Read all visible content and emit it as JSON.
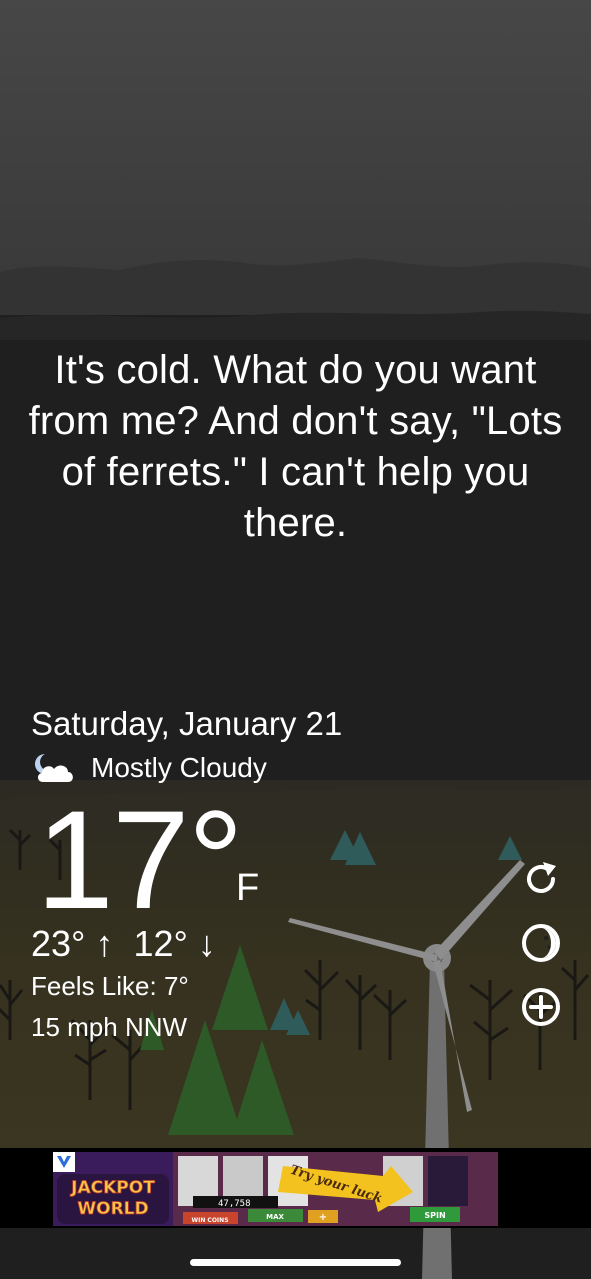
{
  "quote": "It's cold. What do you want from me? And don't say, \"Lots of ferrets.\" I can't help you there.",
  "weather": {
    "date": "Saturday, January 21",
    "condition_icon": "partly-cloudy-night-icon",
    "condition": "Mostly Cloudy",
    "temperature": "17°",
    "unit": "F",
    "high_low": "23° ↑  12° ↓",
    "feels_like": "Feels Like: 7°",
    "wind": "15 mph NNW"
  },
  "side_buttons": [
    {
      "name": "refresh",
      "icon": "refresh-icon"
    },
    {
      "name": "theme",
      "icon": "moon-phase-icon"
    },
    {
      "name": "add-location",
      "icon": "plus-circle-icon"
    }
  ],
  "ad": {
    "logo_text_line1": "JACKPOT",
    "logo_text_line2": "WORLD",
    "slogan": "Try your luck",
    "counter": "47,758",
    "max_label": "MAX",
    "plus_label": "+",
    "spin_label": "SPIN",
    "win_label": "WIN COINS"
  },
  "colors": {
    "sky_top": "#454545",
    "sky_dark": "#1f1f1f",
    "ground": "#3a3524",
    "accent_gold": "#f0b400",
    "tree_green": "#2c5a27"
  }
}
